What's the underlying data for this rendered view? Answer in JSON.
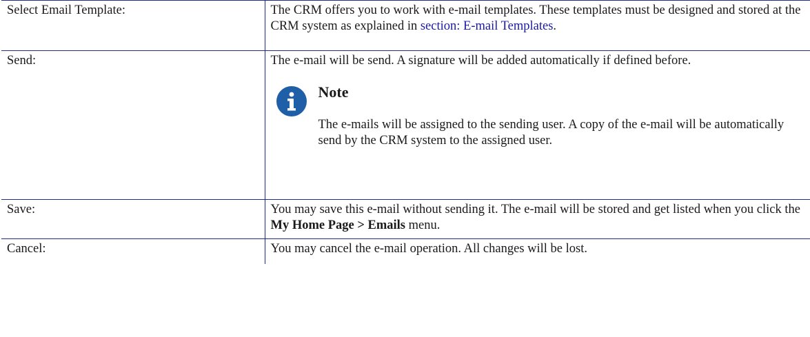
{
  "rows": [
    {
      "term": "Select Email Template:",
      "desc_before": "The CRM offers you to work with e-mail templates. These templates must be designed and stored at the CRM system as explained in",
      "desc_link": "section: E-mail Templates",
      "desc_after": "."
    },
    {
      "term": "Send:",
      "desc": "The e-mail will be send. A signature will be added automatically if defined before.",
      "note_title": "Note",
      "note_body": "The e-mails will be assigned to the sending user. A copy of the e-mail will be automatically send by the CRM system to the assigned user.",
      "note_icon": "info-icon"
    },
    {
      "term": "Save:",
      "desc_before": "You may save this e-mail without sending it. The e-mail will be stored and get listed when you click the",
      "desc_bold": "My Home Page > Emails",
      "desc_after": "menu."
    },
    {
      "term": "Cancel:",
      "desc": "You may cancel the e-mail operation. All changes will be lost."
    }
  ],
  "colors": {
    "border": "#1f2a8c",
    "link": "#1a1aa8",
    "note_icon": "#1f5fa8"
  }
}
